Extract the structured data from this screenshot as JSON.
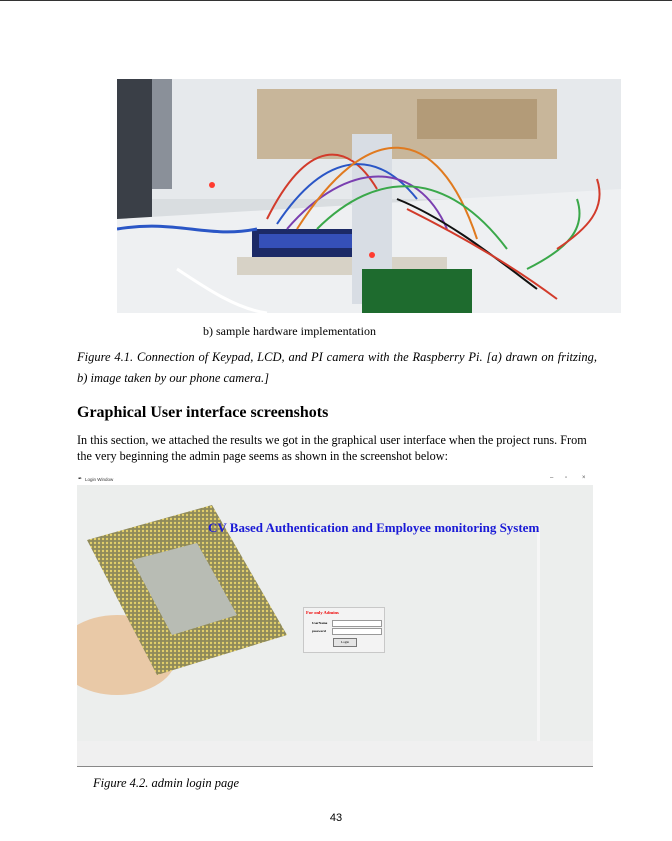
{
  "figure_a": {
    "subcaption": "b) sample hardware implementation",
    "caption": "Figure 4.1.  Connection of Keypad, LCD, and PI camera with the Raspberry Pi. [a) drawn on fritzing, b) image taken by our phone camera.]"
  },
  "section": {
    "heading": "Graphical User interface screenshots",
    "paragraph": "In this section, we attached the results we got in the graphical user interface when the project runs. From the very beginning the admin page seems as shown in the screenshot below:"
  },
  "login_window": {
    "title": "Login Window",
    "app_title": "CV Based Authentication and Employee monitoring System",
    "box_title": "For only Admins",
    "username_label": "UserName",
    "password_label": "password",
    "login_button": "Login"
  },
  "figure_b": {
    "caption": "Figure 4.2. admin login page"
  },
  "page_number": "43",
  "colors": {
    "app_title": "#1a1ad6",
    "box_title": "#e00000"
  }
}
